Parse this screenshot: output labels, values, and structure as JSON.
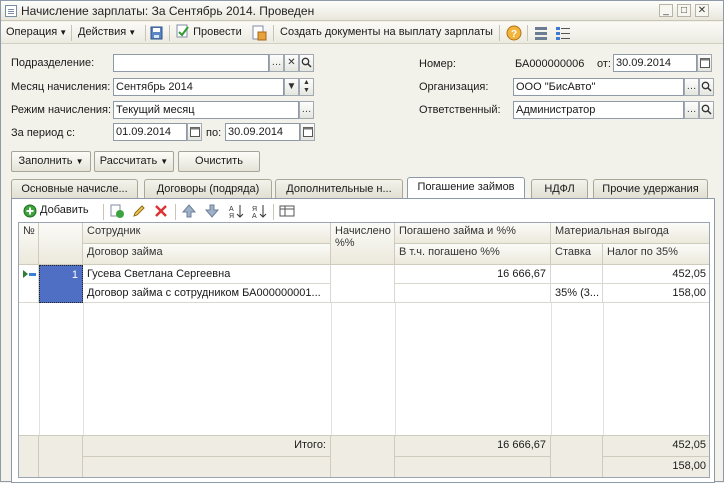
{
  "window": {
    "title": "Начисление зарплаты: За Сентябрь 2014. Проведен"
  },
  "toolbar": {
    "operation": "Операция",
    "actions": "Действия",
    "post": "Провести",
    "create_docs": "Создать документы на выплату зарплаты"
  },
  "form": {
    "subdivision_label": "Подразделение:",
    "subdivision_value": "",
    "month_label": "Месяц начисления:",
    "month_value": "Сентябрь 2014",
    "mode_label": "Режим начисления:",
    "mode_value": "Текущий месяц",
    "period_label": "За период с:",
    "period_from": "01.09.2014",
    "period_to_label": "по:",
    "period_to": "30.09.2014",
    "number_label": "Номер:",
    "number_value": "БА000000006",
    "date_label": "от:",
    "date_value": "30.09.2014",
    "org_label": "Организация:",
    "org_value": "ООО \"БисАвто\"",
    "resp_label": "Ответственный:",
    "resp_value": "Администратор"
  },
  "buttons": {
    "fill": "Заполнить",
    "calculate": "Рассчитать",
    "clear": "Очистить"
  },
  "tabs": [
    {
      "label": "Основные начисле..."
    },
    {
      "label": "Договоры (подряда)"
    },
    {
      "label": "Дополнительные н..."
    },
    {
      "label": "Погашение займов"
    },
    {
      "label": "НДФЛ"
    },
    {
      "label": "Прочие удержания"
    }
  ],
  "grid_toolbar": {
    "add": "Добавить"
  },
  "grid": {
    "headers": {
      "num": "№",
      "employee": "Сотрудник",
      "loan_contract": "Договор займа",
      "accrued": "Начислено %%",
      "repaid": "Погашено займа и %%",
      "repaid_incl": "В т.ч. погашено %%",
      "benefit": "Материальная выгода",
      "rate": "Ставка",
      "tax": "Налог по 35%"
    },
    "row": {
      "num": "1",
      "employee": "Гусева Светлана Сергеевна",
      "loan_contract": "Договор займа с сотрудником БА000000001...",
      "repaid": "16 666,67",
      "rate": "35% (3...",
      "tax_top": "452,05",
      "tax_bottom": "158,00"
    },
    "footer": {
      "total_label": "Итого:",
      "repaid_total": "16 666,67",
      "tax_total": "452,05",
      "tax_total2": "158,00"
    }
  }
}
